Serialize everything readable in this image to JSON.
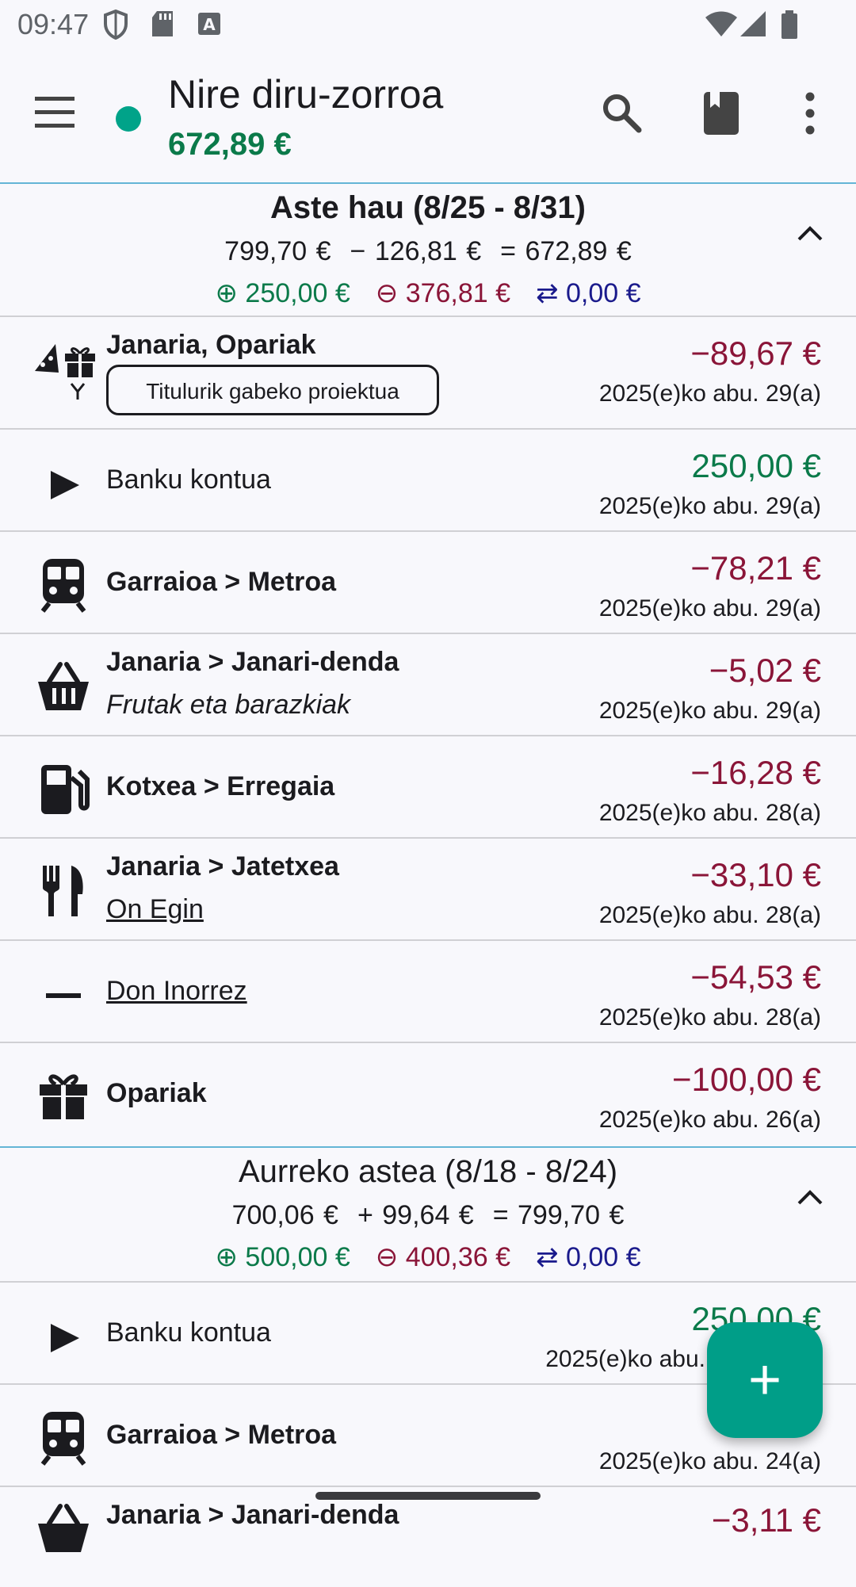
{
  "status_bar": {
    "time": "09:47"
  },
  "app_bar": {
    "title": "Nire diru-zorroa",
    "balance": "672,89 €",
    "icons": [
      "menu-icon",
      "search-icon",
      "book-icon",
      "more-vert-icon"
    ]
  },
  "colors": {
    "income": "#0b7a4a",
    "expense": "#8a1538",
    "transfer": "#1a1a8c",
    "accent": "#009e88"
  },
  "weeks": [
    {
      "title": "Aste hau (8/25 - 8/31)",
      "start": "799,70 €",
      "change": "− 126,81 €",
      "end": "= 672,89 €",
      "income": "⊕ 250,00 €",
      "expense": "⊖ 376,81 €",
      "transfer": "⇄ 0,00 €",
      "transactions": [
        {
          "category": "Janaria, Opariak",
          "chip": "Titulurik gabeko proiektua",
          "amount": "−89,67 €",
          "date": "2025(e)ko abu. 29(a)",
          "icon": "food-gift-split-icon"
        },
        {
          "category": "Banku kontua",
          "amount": "250,00 €",
          "date": "2025(e)ko abu. 29(a)",
          "icon": "play-arrow-icon"
        },
        {
          "category": "Garraioa > Metroa",
          "amount": "−78,21 €",
          "date": "2025(e)ko abu. 29(a)",
          "icon": "train-icon"
        },
        {
          "category": "Janaria > Janari-denda",
          "note": "Frutak eta barazkiak",
          "amount": "−5,02 €",
          "date": "2025(e)ko abu. 29(a)",
          "icon": "basket-icon"
        },
        {
          "category": "Kotxea > Erregaia",
          "amount": "−16,28 €",
          "date": "2025(e)ko abu. 28(a)",
          "icon": "fuel-icon"
        },
        {
          "category": "Janaria > Jatetxea",
          "payee": "On Egin",
          "amount": "−33,10 €",
          "date": "2025(e)ko abu. 28(a)",
          "icon": "restaurant-icon"
        },
        {
          "payee": "Don Inorrez",
          "amount": "−54,53 €",
          "date": "2025(e)ko abu. 28(a)",
          "icon": "minus-icon"
        },
        {
          "category": "Opariak",
          "amount": "−100,00 €",
          "date": "2025(e)ko abu. 26(a)",
          "icon": "gift-icon"
        }
      ]
    },
    {
      "title": "Aurreko astea (8/18 - 8/24)",
      "start": "700,06 €",
      "change": "+ 99,64 €",
      "end": "= 799,70 €",
      "income": "⊕ 500,00 €",
      "expense": "⊖ 400,36 €",
      "transfer": "⇄ 0,00 €",
      "transactions": [
        {
          "category": "Banku kontua",
          "amount": "250,00 €",
          "date": "2025(e)ko abu.",
          "icon": "play-arrow-icon"
        },
        {
          "category": "Garraioa > Metroa",
          "amount": "−",
          "date": "2025(e)ko abu. 24(a)",
          "icon": "train-icon"
        },
        {
          "category": "Janaria > Janari-denda",
          "amount": "−3,11 €",
          "icon": "basket-icon"
        }
      ]
    }
  ],
  "fab": {
    "label": "+"
  }
}
